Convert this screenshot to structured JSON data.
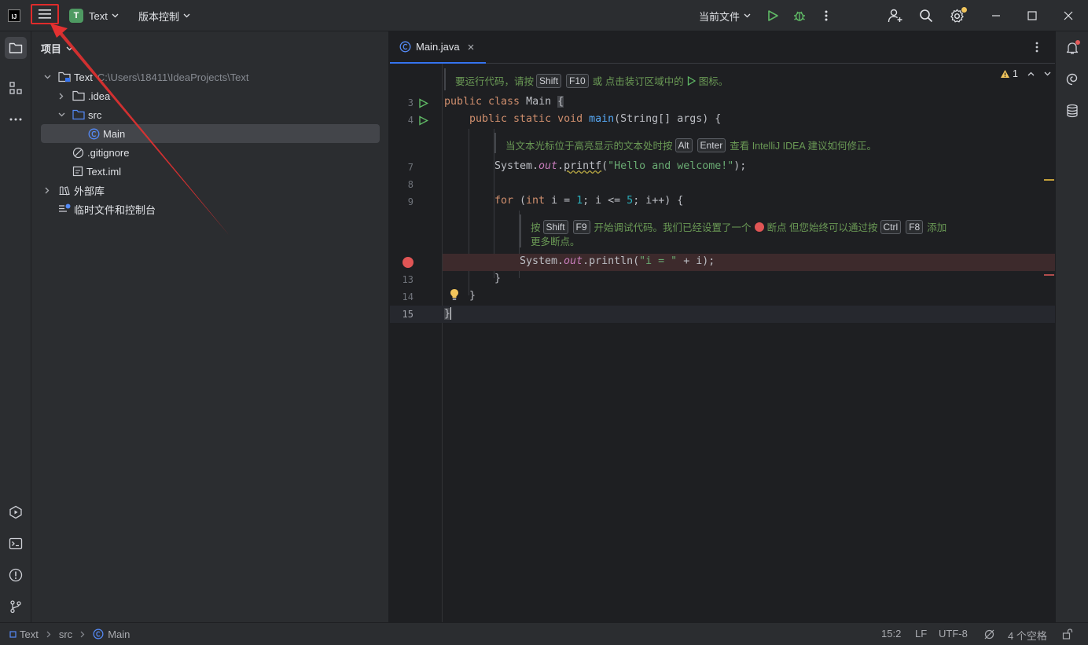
{
  "titlebar": {
    "logo_text": "IJ",
    "project_badge": "T",
    "project_name": "Text",
    "vcs_label": "版本控制",
    "run_config": "当前文件"
  },
  "project_panel": {
    "title": "项目",
    "tree": [
      {
        "label": "Text",
        "path": "C:\\Users\\18411\\IdeaProjects\\Text"
      },
      {
        "label": ".idea"
      },
      {
        "label": "src"
      },
      {
        "label": "Main"
      },
      {
        "label": ".gitignore"
      },
      {
        "label": "Text.iml"
      },
      {
        "label": "外部库"
      },
      {
        "label": "临时文件和控制台"
      }
    ]
  },
  "editor": {
    "tab_label": "Main.java",
    "warning_count": "1",
    "hints": {
      "h1": {
        "t1": "要运行代码，请按",
        "k1": "Shift",
        "k2": "F10",
        "t2": "或 点击装订区域中的",
        "t3": "图标。"
      },
      "h2": {
        "t1": "当文本光标位于高亮显示的文本处时按",
        "k1": "Alt",
        "k2": "Enter",
        "t2": "查看 IntelliJ IDEA 建议如何修正。"
      },
      "h3": {
        "t1": "按",
        "k1": "Shift",
        "k2": "F9",
        "t2": "开始调试代码。我们已经设置了一个",
        "t3": "断点 但您始终可以通过按",
        "k3": "Ctrl",
        "k4": "F8",
        "t4": "添加",
        "t5": "更多断点。"
      }
    },
    "line_numbers": [
      "3",
      "4",
      "7",
      "8",
      "9",
      "13",
      "14",
      "15"
    ],
    "code": {
      "l3_a": "public class ",
      "l3_b": "Main ",
      "l3_c": "{",
      "l4_a": "public static void ",
      "l4_b": "main",
      "l4_c": "(String[] args) {",
      "l7_a": "System.",
      "l7_b": "out",
      "l7_c": ".",
      "l7_d": "printf",
      "l7_e": "(",
      "l7_f": "\"Hello and welcome!\"",
      "l7_g": ");",
      "l9_a": "for ",
      "l9_b": "(",
      "l9_c": "int ",
      "l9_d": "i = ",
      "l9_e": "1",
      "l9_f": "; i <= ",
      "l9_g": "5",
      "l9_h": "; i++) {",
      "l12_a": "System.",
      "l12_b": "out",
      "l12_c": ".println(",
      "l12_d": "\"i = \"",
      "l12_e": " + i);",
      "l13": "}",
      "l14": "}",
      "l15": "}"
    }
  },
  "statusbar": {
    "crumbs": [
      "Text",
      "src",
      "Main"
    ],
    "position": "15:2",
    "line_sep": "LF",
    "encoding": "UTF-8",
    "indent": "4 个空格"
  },
  "colors": {
    "accent": "#3574f0",
    "highlight_box": "#e02b2b",
    "arrow": "#e33131",
    "breakpoint": "#e05555",
    "run_green": "#5fb865"
  }
}
